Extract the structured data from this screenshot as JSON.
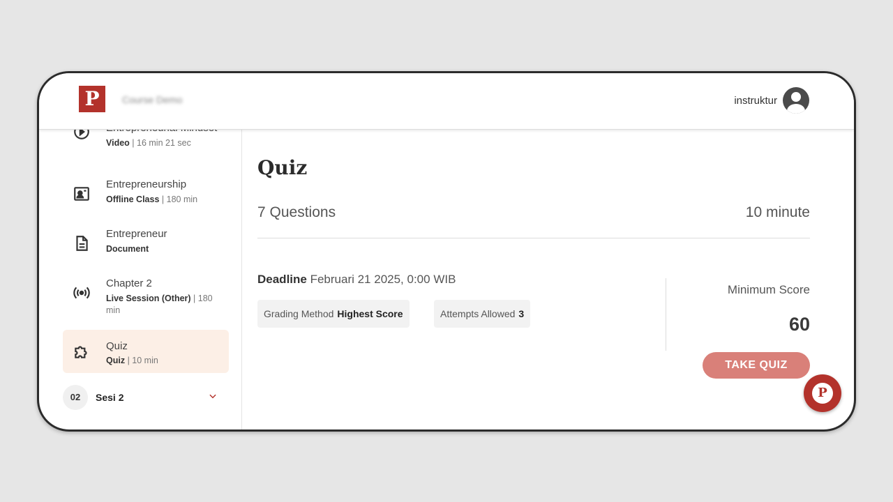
{
  "header": {
    "logo_letter": "P",
    "brand_name": "Course Demo",
    "username": "instruktur"
  },
  "sidebar": {
    "lessons": [
      {
        "title": "Entrepreneurial Mindset",
        "type": "Video",
        "detail": " | 16 min 21 sec",
        "icon": "video-icon"
      },
      {
        "title": "Entrepreneurship",
        "type": "Offline Class",
        "detail": " | 180 min",
        "icon": "classroom-icon"
      },
      {
        "title": "Entrepreneur",
        "type": "Document",
        "detail": "",
        "icon": "document-icon"
      },
      {
        "title": "Chapter 2",
        "type": "Live Session (Other)",
        "detail": " | 180 min",
        "icon": "broadcast-icon"
      },
      {
        "title": "Quiz",
        "type": "Quiz",
        "detail": " | 10 min",
        "icon": "puzzle-icon"
      }
    ],
    "session": {
      "number": "02",
      "label": "Sesi 2"
    }
  },
  "main": {
    "title": "Quiz",
    "questions": "7 Questions",
    "duration": "10 minute",
    "deadline_label": "Deadline",
    "deadline_value": " Februari 21 2025, 0:00 WIB",
    "grading_label": "Grading Method",
    "grading_value": "Highest Score",
    "attempts_label": "Attempts Allowed",
    "attempts_value": "3",
    "min_score_label": "Minimum Score",
    "min_score_value": "60",
    "take_button": "TAKE QUIZ"
  },
  "fab": {
    "letter": "P"
  },
  "colors": {
    "brand": "#b3322b",
    "button": "#d98079",
    "active_bg": "#fcefe6"
  }
}
